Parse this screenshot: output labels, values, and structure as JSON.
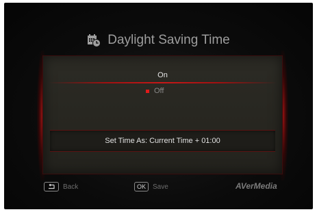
{
  "header": {
    "title": "Daylight Saving Time",
    "icon": "calendar-clock-icon"
  },
  "options": {
    "on_label": "On",
    "off_label": "Off",
    "selected": "On",
    "off_marker_color": "#e01a1a"
  },
  "setting": {
    "label": "Set Time As: Current Time + 01:00"
  },
  "footer": {
    "back_key_icon": "return-arrow-icon",
    "back_label": "Back",
    "save_key": "OK",
    "save_label": "Save",
    "brand": "AVerMedia"
  },
  "colors": {
    "accent": "#c81818",
    "panel": "#2a2923",
    "background": "#0b0b0b"
  }
}
